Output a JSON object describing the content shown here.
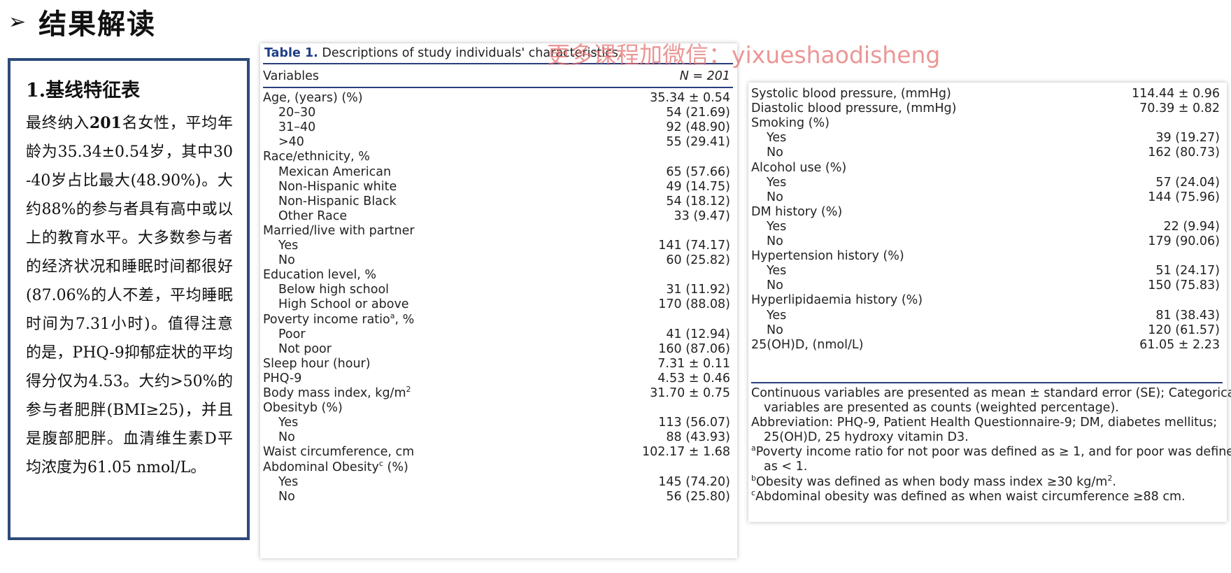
{
  "header": {
    "arrow": "➢",
    "title": "结果解读"
  },
  "summary": {
    "heading": "1.基线特征表",
    "body_1": "最终纳入",
    "body_bold": "201",
    "body_2": "名女性，平均年龄为35.34±0.54岁，其中30-40岁占比最大(48.90%)。大约88%的参与者具有高中或以上的教育水平。大多数参与者的经济状况和睡眠时间都很好(87.06%的人不差，平均睡眠时间为7.31小时)。值得注意的是，PHQ-9抑郁症状的平均得分仅为4.53。大约>50%的参与者肥胖(BMI≥25)，并且是腹部肥胖。血清维生素D平均浓度为61.05 nmol/L。"
  },
  "watermark": "更多课程加微信：yixueshaodisheng",
  "table": {
    "caption_num": "Table 1.",
    "caption_text": "Descriptions of study individuals' characteristics.",
    "col_variable": "Variables",
    "col_n": "N = 201",
    "left_rows": [
      {
        "label": "Age, (years) (%)",
        "value": "35.34 ± 0.54",
        "sub": false
      },
      {
        "label": "20–30",
        "value": "54 (21.69)",
        "sub": true
      },
      {
        "label": "31–40",
        "value": "92 (48.90)",
        "sub": true
      },
      {
        "label": ">40",
        "value": "55 (29.41)",
        "sub": true
      },
      {
        "label": "Race/ethnicity, %",
        "value": "",
        "sub": false
      },
      {
        "label": "Mexican American",
        "value": "65 (57.66)",
        "sub": true
      },
      {
        "label": "Non-Hispanic white",
        "value": "49 (14.75)",
        "sub": true
      },
      {
        "label": "Non-Hispanic Black",
        "value": "54 (18.12)",
        "sub": true
      },
      {
        "label": "Other Race",
        "value": "33 (9.47)",
        "sub": true
      },
      {
        "label": "Married/live with partner",
        "value": "",
        "sub": false
      },
      {
        "label": "Yes",
        "value": "141 (74.17)",
        "sub": true
      },
      {
        "label": "No",
        "value": "60 (25.82)",
        "sub": true
      },
      {
        "label": "Education level, %",
        "value": "",
        "sub": false
      },
      {
        "label": "Below high school",
        "value": "31 (11.92)",
        "sub": true
      },
      {
        "label": "High School or above",
        "value": "170 (88.08)",
        "sub": true
      },
      {
        "label": "Poverty income ratio",
        "sup": "a",
        "tail": ", %",
        "value": "",
        "sub": false
      },
      {
        "label": "Poor",
        "value": "41 (12.94)",
        "sub": true
      },
      {
        "label": "Not poor",
        "value": "160 (87.06)",
        "sub": true
      },
      {
        "label": "Sleep hour (hour)",
        "value": "7.31 ± 0.11",
        "sub": false
      },
      {
        "label": "PHQ-9",
        "value": "4.53 ± 0.46",
        "sub": false
      },
      {
        "label": "Body mass index, kg/m",
        "sup": "2",
        "tail": "",
        "value": "31.70 ± 0.75",
        "sub": false
      },
      {
        "label": "Obesityb (%)",
        "value": "",
        "sub": false
      },
      {
        "label": "Yes",
        "value": "113 (56.07)",
        "sub": true
      },
      {
        "label": "No",
        "value": "88 (43.93)",
        "sub": true
      },
      {
        "label": "Waist circumference, cm",
        "value": "102.17 ± 1.68",
        "sub": false
      },
      {
        "label": "Abdominal Obesity",
        "sup": "c",
        "tail": " (%)",
        "value": "",
        "sub": false
      },
      {
        "label": "Yes",
        "value": "145 (74.20)",
        "sub": true
      },
      {
        "label": "No",
        "value": "56 (25.80)",
        "sub": true
      }
    ],
    "right_rows": [
      {
        "label": "Systolic blood pressure, (mmHg)",
        "value": "114.44 ± 0.96",
        "sub": false
      },
      {
        "label": "Diastolic blood pressure, (mmHg)",
        "value": "70.39 ± 0.82",
        "sub": false
      },
      {
        "label": "Smoking (%)",
        "value": "",
        "sub": false
      },
      {
        "label": "Yes",
        "value": "39 (19.27)",
        "sub": true
      },
      {
        "label": "No",
        "value": "162 (80.73)",
        "sub": true
      },
      {
        "label": "Alcohol use (%)",
        "value": "",
        "sub": false
      },
      {
        "label": "Yes",
        "value": "57 (24.04)",
        "sub": true
      },
      {
        "label": "No",
        "value": "144 (75.96)",
        "sub": true
      },
      {
        "label": "DM history (%)",
        "value": "",
        "sub": false
      },
      {
        "label": "Yes",
        "value": "22 (9.94)",
        "sub": true
      },
      {
        "label": "No",
        "value": "179 (90.06)",
        "sub": true
      },
      {
        "label": "Hypertension history (%)",
        "value": "",
        "sub": false
      },
      {
        "label": "Yes",
        "value": "51 (24.17)",
        "sub": true
      },
      {
        "label": "No",
        "value": "150 (75.83)",
        "sub": true
      },
      {
        "label": "Hyperlipidaemia history (%)",
        "value": "",
        "sub": false
      },
      {
        "label": "Yes",
        "value": "81 (38.43)",
        "sub": true
      },
      {
        "label": "No",
        "value": "120 (61.57)",
        "sub": true
      },
      {
        "label": "25(OH)D, (nmol/L)",
        "value": "61.05 ± 2.23",
        "sub": false
      }
    ],
    "notes": [
      {
        "sup": "",
        "text": "Continuous variables are presented as mean ± standard error (SE); Categorical",
        "indent": false
      },
      {
        "sup": "",
        "text": "variables are presented as counts (weighted percentage).",
        "indent": true
      },
      {
        "sup": "",
        "text": "Abbreviation: PHQ-9, Patient Health Questionnaire-9; DM, diabetes mellitus;",
        "indent": false
      },
      {
        "sup": "",
        "text": "25(OH)D, 25 hydroxy vitamin D3.",
        "indent": true
      },
      {
        "sup": "a",
        "text": "Poverty income ratio for not poor was defined as ≥ 1, and for poor was defined",
        "indent": false
      },
      {
        "sup": "",
        "text": "as < 1.",
        "indent": true
      },
      {
        "sup": "b",
        "text": "Obesity was defined as when body mass index ≥30 kg/m",
        "tail_sup": "2",
        "tail": ".",
        "indent": false
      },
      {
        "sup": "c",
        "text": "Abdominal obesity was defined as when waist circumference ≥88 cm.",
        "indent": false
      }
    ]
  }
}
